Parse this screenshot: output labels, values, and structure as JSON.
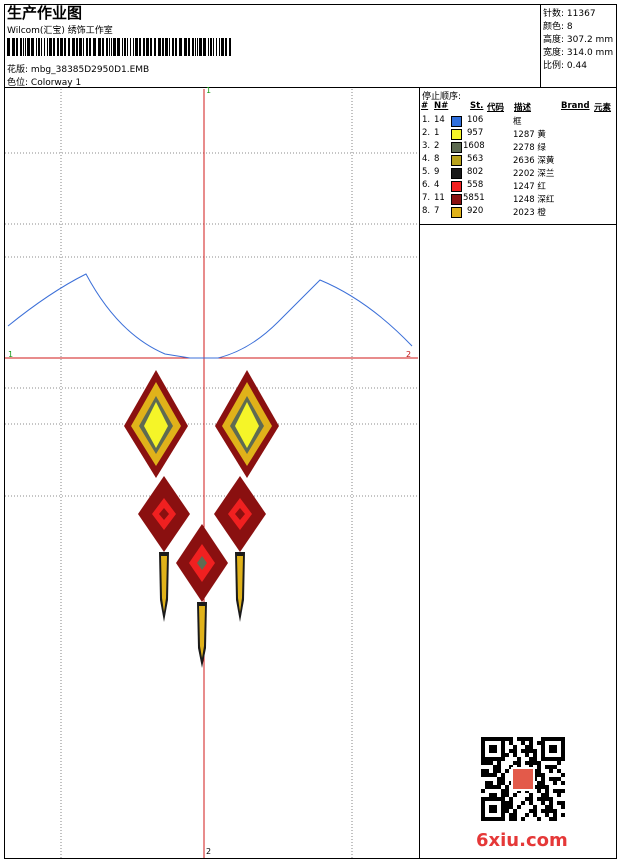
{
  "header": {
    "title": "生产作业图",
    "company": "Wilcom(汇宝) 绣饰工作室",
    "design_label": "花版:",
    "design_name": "mbg_38385D2950D1.EMB",
    "colorway_label": "色位:",
    "colorway_name": "Colorway 1"
  },
  "stats": [
    {
      "label": "针数:",
      "value": "11367"
    },
    {
      "label": "颜色:",
      "value": "8"
    },
    {
      "label": "高度:",
      "value": "307.2 mm"
    },
    {
      "label": "宽度:",
      "value": "314.0 mm"
    },
    {
      "label": "比例:",
      "value": "0.44"
    }
  ],
  "stop_sequence": {
    "title": "停止顺序:",
    "headers": {
      "num": "#",
      "needle": "N#",
      "st": "St.",
      "code": "代码",
      "desc": "描述",
      "brand": "Brand",
      "element": "元素"
    },
    "rows": [
      {
        "num": "1.",
        "needle": "14",
        "color": "#2f6fdc",
        "st": "106",
        "desc": "框"
      },
      {
        "num": "2.",
        "needle": "1",
        "color": "#f5f528",
        "st": "957",
        "desc": "1287 黄"
      },
      {
        "num": "3.",
        "needle": "2",
        "color": "#5e6b52",
        "st": "1608",
        "desc": "2278 绿"
      },
      {
        "num": "4.",
        "needle": "8",
        "color": "#b9a21c",
        "st": "563",
        "desc": "2636 深黄"
      },
      {
        "num": "5.",
        "needle": "9",
        "color": "#1a1a1a",
        "st": "802",
        "desc": "2202 深兰"
      },
      {
        "num": "6.",
        "needle": "4",
        "color": "#f02020",
        "st": "558",
        "desc": "1247 红"
      },
      {
        "num": "7.",
        "needle": "11",
        "color": "#8a1010",
        "st": "5851",
        "desc": "1248 深红"
      },
      {
        "num": "8.",
        "needle": "7",
        "color": "#e0b21a",
        "st": "920",
        "desc": "2023 橙"
      }
    ]
  },
  "markers": {
    "one": "1",
    "two": "2"
  },
  "colors": {
    "guide": "#d11a1a",
    "frame_outline": "#3b6fd8",
    "dotted": "#555555"
  },
  "footer_logo": "6xiu.com"
}
